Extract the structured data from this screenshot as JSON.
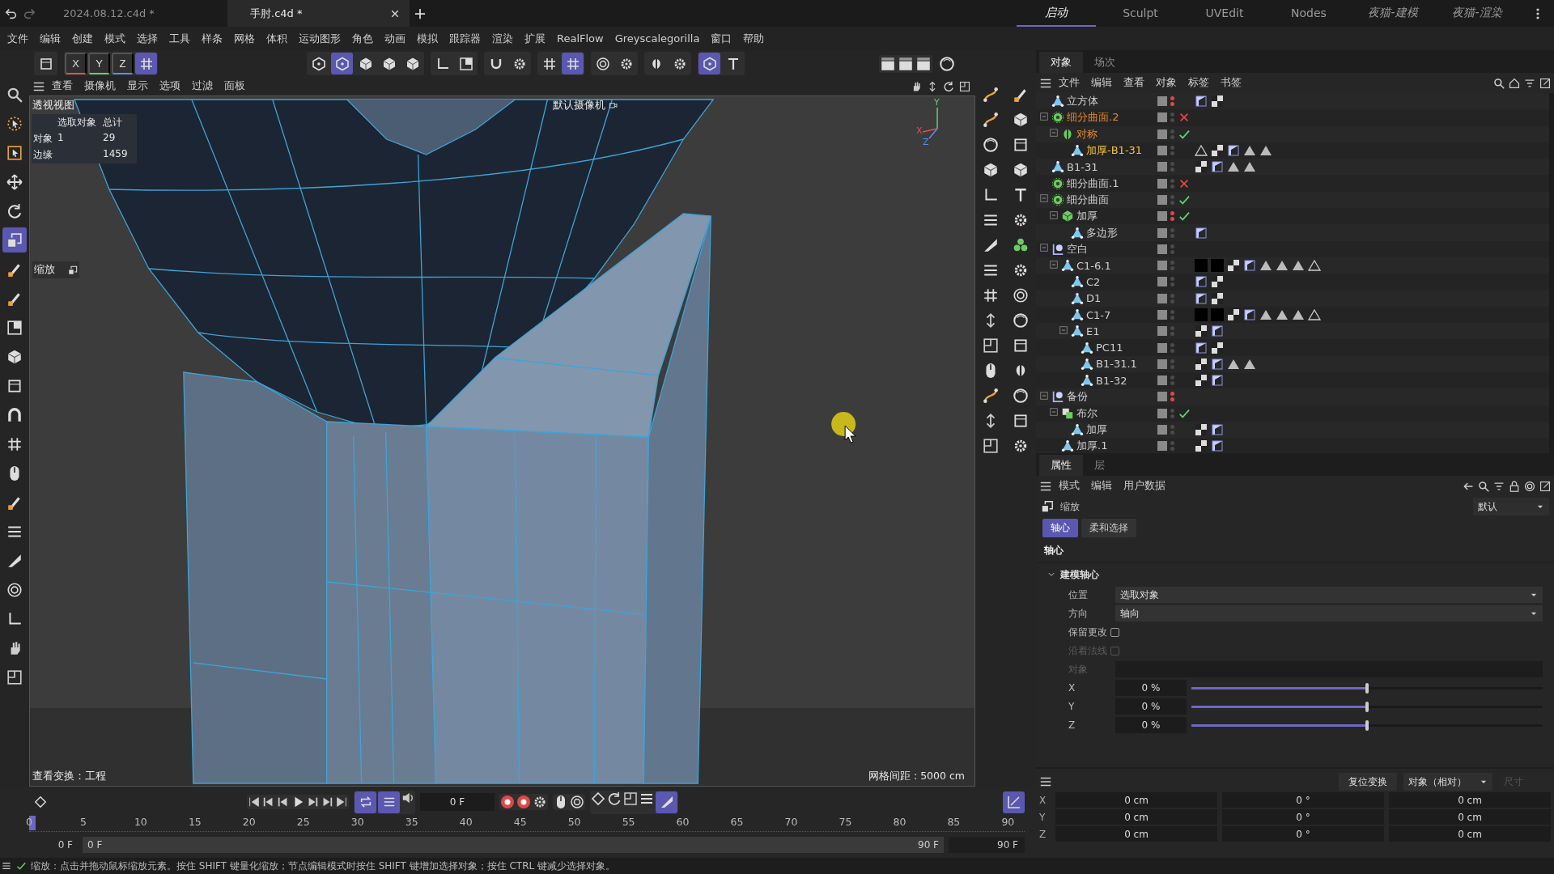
{
  "file_tabs": [
    {
      "label": "2024.08.12.c4d *",
      "selected": false
    },
    {
      "label": "手肘.c4d *",
      "selected": true
    }
  ],
  "layouts": [
    {
      "label": "启动",
      "selected": true,
      "custom": true
    },
    {
      "label": "Sculpt",
      "selected": false,
      "custom": false
    },
    {
      "label": "UVEdit",
      "selected": false,
      "custom": false
    },
    {
      "label": "Nodes",
      "selected": false,
      "custom": false
    },
    {
      "label": "夜猫-建模",
      "selected": false,
      "custom": true
    },
    {
      "label": "夜猫-渲染",
      "selected": false,
      "custom": true
    }
  ],
  "menu": [
    "文件",
    "编辑",
    "创建",
    "模式",
    "选择",
    "工具",
    "样条",
    "网格",
    "体积",
    "运动图形",
    "角色",
    "动画",
    "模拟",
    "跟踪器",
    "渲染",
    "扩展",
    "RealFlow",
    "Greyscalegorilla",
    "窗口",
    "帮助"
  ],
  "toolbar": {
    "axis_buttons": [
      {
        "label": "X",
        "selected": false
      },
      {
        "label": "Y",
        "selected": false
      },
      {
        "label": "Z",
        "selected": false
      }
    ],
    "world_selected": true,
    "groups": [
      [
        {
          "selected": false
        },
        {
          "selected": true
        },
        {
          "selected": false
        },
        {
          "selected": false
        },
        {
          "selected": false
        }
      ],
      [
        {
          "selected": false
        },
        {
          "selected": false
        }
      ],
      [
        {
          "selected": false
        },
        {
          "selected": false
        }
      ],
      [
        {
          "selected": false
        },
        {
          "selected": true
        }
      ],
      [
        {
          "selected": false
        },
        {
          "selected": false
        }
      ],
      [
        {
          "selected": false
        },
        {
          "selected": false
        }
      ],
      [
        {
          "selected": true
        },
        {
          "selected": false
        }
      ]
    ]
  },
  "tools": [
    {
      "selected": false
    },
    {
      "selected": false
    },
    {
      "selected": false
    },
    {
      "selected": false
    },
    {
      "selected": false
    },
    {
      "selected": true
    },
    {
      "selected": false
    },
    {
      "selected": false
    },
    {
      "selected": false
    },
    {
      "selected": false
    },
    {
      "selected": false
    },
    {
      "selected": false
    },
    {
      "selected": false
    },
    {
      "selected": false
    },
    {
      "selected": false
    },
    {
      "selected": false
    },
    {
      "selected": false
    },
    {
      "selected": false
    },
    {
      "selected": false
    },
    {
      "selected": false
    },
    {
      "selected": false
    }
  ],
  "viewport": {
    "menu": [
      "查看",
      "摄像机",
      "显示",
      "选项",
      "过滤",
      "面板"
    ],
    "view_name": "透视视图",
    "camera": "默认摄像机",
    "hud": {
      "columns": [
        "选取对象",
        "总计"
      ],
      "rows": [
        {
          "label": "对象",
          "selection": "1",
          "total": "29"
        },
        {
          "label": "边缘",
          "total": "1459"
        }
      ]
    },
    "tool_label": "缩放",
    "axis_labels": [
      "Y",
      "X",
      "Z"
    ],
    "footer_left": "查看变换：工程",
    "footer_right": "网格间距 : 5000 cm"
  },
  "timeline": {
    "transport": [
      {
        "selected": true
      },
      {
        "selected": true
      }
    ],
    "current_frame": "0 F",
    "snap_selected": true,
    "ruler": [
      "0",
      "5",
      "10",
      "15",
      "20",
      "25",
      "30",
      "35",
      "40",
      "45",
      "50",
      "55",
      "60",
      "65",
      "70",
      "75",
      "80",
      "85",
      "90"
    ],
    "playhead": {
      "level": 0
    },
    "range": {
      "start": "0 F",
      "preview_start": "0 F",
      "preview_end": "90 F",
      "end": "90 F"
    }
  },
  "objects": {
    "tabs": [
      {
        "label": "对象",
        "selected": true
      },
      {
        "label": "场次",
        "selected": false
      }
    ],
    "menu": [
      "文件",
      "编辑",
      "查看",
      "对象",
      "标签",
      "书签"
    ],
    "tree": [
      {
        "name": "立方体",
        "kind": "polygon",
        "selected": false,
        "hidden": true,
        "tags": [
          {
            "kind": "phong"
          },
          {
            "kind": "texture"
          }
        ]
      },
      {
        "name": "细分曲面.2",
        "kind": "subdivision",
        "selected": false,
        "hidden": false,
        "enabled": false,
        "expanded": true,
        "children": [
          {
            "name": "对称",
            "kind": "symmetry",
            "selected": false,
            "hidden": false,
            "enabled": true,
            "expanded": true,
            "children": [
              {
                "name": "加厚-B1-31",
                "kind": "polygon",
                "selected": true,
                "hidden": false,
                "tags": [
                  {
                    "kind": "triangle-outline"
                  },
                  {
                    "kind": "texture"
                  },
                  {
                    "kind": "phong"
                  },
                  {
                    "kind": "triangle"
                  },
                  {
                    "kind": "triangle"
                  }
                ]
              }
            ]
          }
        ]
      },
      {
        "name": "B1-31",
        "kind": "polygon",
        "selected": false,
        "hidden": false,
        "tags": [
          {
            "kind": "texture"
          },
          {
            "kind": "phong"
          },
          {
            "kind": "triangle"
          },
          {
            "kind": "triangle"
          }
        ]
      },
      {
        "name": "细分曲面.1",
        "kind": "subdivision",
        "selected": false,
        "hidden": false,
        "enabled": false
      },
      {
        "name": "细分曲面",
        "kind": "subdivision",
        "selected": false,
        "hidden": false,
        "enabled": true,
        "expanded": true,
        "children": [
          {
            "name": "加厚",
            "kind": "extrude",
            "selected": false,
            "hidden": true,
            "enabled": true,
            "expanded": true,
            "children": [
              {
                "name": "多边形",
                "kind": "polygon",
                "selected": false,
                "hidden": false,
                "tags": [
                  {
                    "kind": "phong"
                  }
                ]
              }
            ]
          }
        ]
      },
      {
        "name": "空白",
        "kind": "null",
        "selected": false,
        "hidden": false,
        "expanded": true,
        "children": [
          {
            "name": "C1-6.1",
            "kind": "polygon",
            "selected": false,
            "hidden": false,
            "expanded": true,
            "tags": [
              {
                "kind": "material"
              },
              {
                "kind": "material"
              },
              {
                "kind": "texture"
              },
              {
                "kind": "phong"
              },
              {
                "kind": "triangle"
              },
              {
                "kind": "triangle"
              },
              {
                "kind": "triangle"
              },
              {
                "kind": "triangle-outline"
              }
            ],
            "children": [
              {
                "name": "C2",
                "kind": "polygon",
                "selected": false,
                "hidden": false,
                "tags": [
                  {
                    "kind": "phong"
                  },
                  {
                    "kind": "texture"
                  }
                ]
              },
              {
                "name": "D1",
                "kind": "polygon",
                "selected": false,
                "hidden": false,
                "tags": [
                  {
                    "kind": "phong"
                  },
                  {
                    "kind": "texture"
                  }
                ]
              },
              {
                "name": "C1-7",
                "kind": "polygon",
                "selected": false,
                "hidden": false,
                "tags": [
                  {
                    "kind": "material"
                  },
                  {
                    "kind": "material"
                  },
                  {
                    "kind": "texture"
                  },
                  {
                    "kind": "phong"
                  },
                  {
                    "kind": "triangle"
                  },
                  {
                    "kind": "triangle"
                  },
                  {
                    "kind": "triangle"
                  },
                  {
                    "kind": "triangle-outline"
                  }
                ]
              },
              {
                "name": "E1",
                "kind": "polygon",
                "selected": false,
                "hidden": false,
                "expanded": true,
                "tags": [
                  {
                    "kind": "texture"
                  },
                  {
                    "kind": "phong"
                  }
                ],
                "children": [
                  {
                    "name": "PC11",
                    "kind": "polygon",
                    "selected": false,
                    "hidden": false,
                    "tags": [
                      {
                        "kind": "phong"
                      },
                      {
                        "kind": "texture"
                      }
                    ]
                  },
                  {
                    "name": "B1-31.1",
                    "kind": "polygon",
                    "selected": false,
                    "hidden": false,
                    "tags": [
                      {
                        "kind": "texture"
                      },
                      {
                        "kind": "phong"
                      },
                      {
                        "kind": "triangle"
                      },
                      {
                        "kind": "triangle"
                      }
                    ]
                  },
                  {
                    "name": "B1-32",
                    "kind": "polygon",
                    "selected": false,
                    "hidden": false,
                    "tags": [
                      {
                        "kind": "texture"
                      },
                      {
                        "kind": "phong"
                      }
                    ]
                  }
                ]
              }
            ]
          }
        ]
      },
      {
        "name": "备份",
        "kind": "null",
        "selected": false,
        "hidden": true,
        "expanded": true,
        "children": [
          {
            "name": "布尔",
            "kind": "boole",
            "selected": false,
            "hidden": false,
            "enabled": true,
            "expanded": true,
            "children": [
              {
                "name": "加厚",
                "kind": "polygon",
                "selected": false,
                "hidden": false,
                "tags": [
                  {
                    "kind": "texture"
                  },
                  {
                    "kind": "phong"
                  }
                ]
              }
            ]
          },
          {
            "name": "加厚.1",
            "kind": "polygon",
            "selected": false,
            "hidden": false,
            "tags": [
              {
                "kind": "texture"
              },
              {
                "kind": "phong"
              }
            ]
          }
        ]
      }
    ]
  },
  "attributes": {
    "tabs": [
      {
        "label": "属性",
        "selected": true
      },
      {
        "label": "层",
        "selected": false
      }
    ],
    "menu": [
      "模式",
      "编辑",
      "用户数据"
    ],
    "title": "缩放",
    "preset": "默认",
    "subtabs": [
      {
        "label": "轴心",
        "selected": true
      },
      {
        "label": "柔和选择",
        "selected": false
      }
    ],
    "section": "轴心",
    "group": {
      "label": "建模轴心",
      "expanded": true
    },
    "fields": [
      {
        "kind": "dropdown",
        "label": "位置",
        "value": "选取对象",
        "disabled": false
      },
      {
        "kind": "dropdown",
        "label": "方向",
        "value": "轴向",
        "disabled": false
      },
      {
        "kind": "checkbox",
        "label": "保留更改",
        "checked": false,
        "disabled": false
      },
      {
        "kind": "checkbox",
        "label": "沿着法线",
        "checked": false,
        "disabled": true
      },
      {
        "kind": "link",
        "label": "对象",
        "disabled": true
      },
      {
        "kind": "slider",
        "label": "X",
        "value": "0 %",
        "level": 0.5,
        "disabled": false
      },
      {
        "kind": "slider",
        "label": "Y",
        "value": "0 %",
        "level": 0.5,
        "disabled": false
      },
      {
        "kind": "slider",
        "label": "Z",
        "value": "0 %",
        "level": 0.5,
        "disabled": false
      }
    ]
  },
  "coordinates": {
    "reset_button": "复位变换",
    "mode": "对象（相对）",
    "size_mode": {
      "label": "尺寸",
      "disabled": true
    },
    "rows": [
      {
        "axis": "X",
        "values": [
          "0 cm",
          "0 °",
          "0 cm"
        ]
      },
      {
        "axis": "Y",
        "values": [
          "0 cm",
          "0 °",
          "0 cm"
        ]
      },
      {
        "axis": "Z",
        "values": [
          "0 cm",
          "0 °",
          "0 cm"
        ]
      }
    ]
  },
  "status_bar": "缩放：点击并拖动鼠标缩放元素。按住 SHIFT 键量化缩放；节点编辑模式时按住 SHIFT 键增加选择对象；按住 CTRL 键减少选择对象。"
}
